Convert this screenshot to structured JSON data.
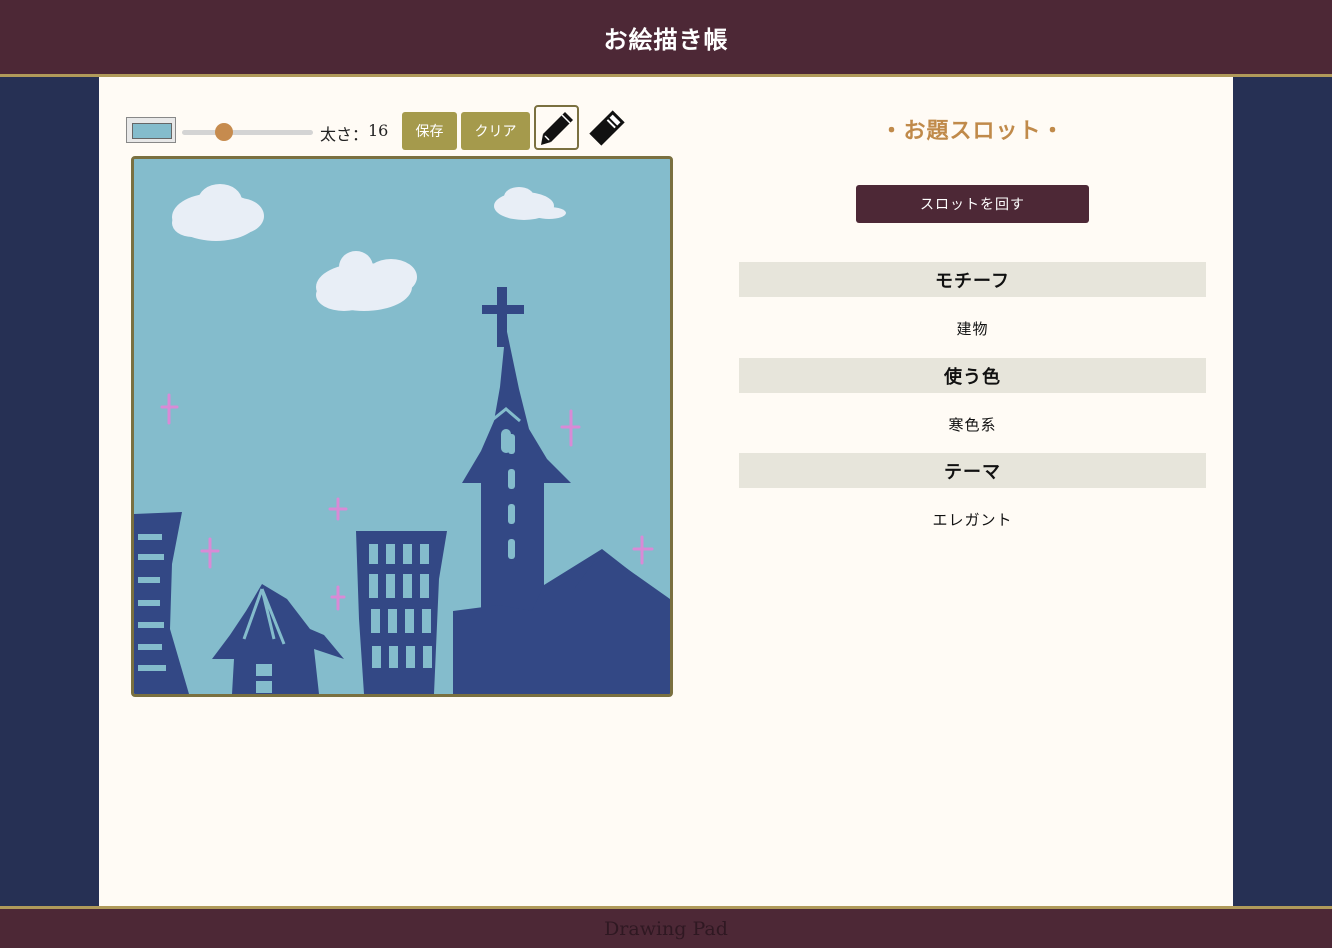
{
  "app": {
    "title": "お絵描き帳",
    "footer": "Drawing Pad"
  },
  "toolbar": {
    "current_color": "#84bccc",
    "brush_size_label": "太さ：",
    "brush_size": "16",
    "brush_size_value": 16,
    "brush_size_max": 50,
    "save_label": "保存",
    "clear_label": "クリア",
    "pen_icon": "pencil-icon",
    "eraser_icon": "eraser-icon",
    "active_tool": "pen"
  },
  "canvas": {
    "background": "#84bccc",
    "colors": {
      "sky": "#84bccc",
      "buildings": "#334885",
      "clouds": "#e8eef6",
      "sparkles": "#d98ad6"
    }
  },
  "slot": {
    "title": "・お題スロット・",
    "spin_label": "スロットを回す",
    "items": [
      {
        "label": "モチーフ",
        "value": "建物"
      },
      {
        "label": "使う色",
        "value": "寒色系"
      },
      {
        "label": "テーマ",
        "value": "エレガント"
      }
    ]
  },
  "colors": {
    "header": "#4d2836",
    "side": "#263054",
    "panel": "#fffbf5",
    "accent": "#a59a4c",
    "title": "#c08a4a"
  }
}
